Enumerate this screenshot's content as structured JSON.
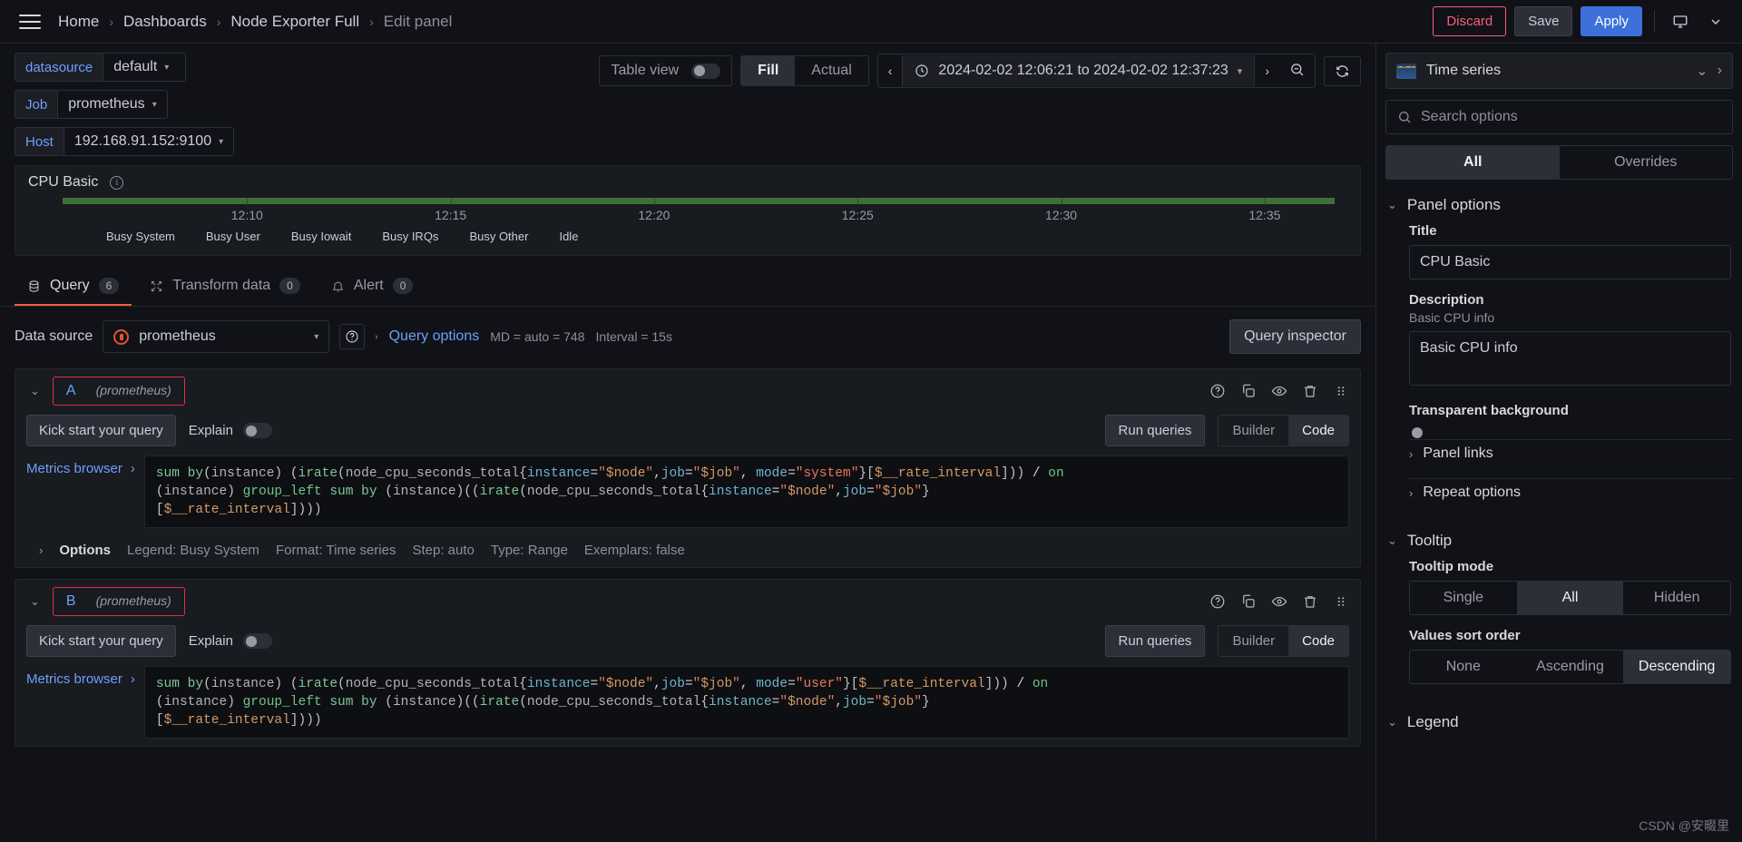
{
  "topnav": {
    "menu_icon": "hamburger-menu-icon",
    "breadcrumbs": [
      "Home",
      "Dashboards",
      "Node Exporter Full",
      "Edit panel"
    ],
    "separator": "›",
    "discard_label": "Discard",
    "save_label": "Save",
    "apply_label": "Apply",
    "tv_icon": "tv-display-icon",
    "chevron_icon": "chevron-down-icon",
    "accent_apply": "#3d71d9",
    "accent_discard": "#f55f7d"
  },
  "variables": [
    {
      "label": "datasource",
      "value": "default"
    },
    {
      "label": "Job",
      "value": "prometheus"
    },
    {
      "label": "Host",
      "value": "192.168.91.152:9100"
    }
  ],
  "toolbar": {
    "table_view_label": "Table view",
    "table_view_on": false,
    "fill_label": "Fill",
    "actual_label": "Actual",
    "fill_active": true,
    "time_range": "2024-02-02 12:06:21 to 2024-02-02 12:37:23",
    "prev_arrow": "‹",
    "next_arrow": "›",
    "clock_icon": "clock-icon",
    "zoom_out_icon": "zoom-out-icon",
    "refresh_icon": "refresh-icon"
  },
  "panel": {
    "title": "CPU Basic",
    "info_icon": "info-circle-icon",
    "series_color": "#56a64b"
  },
  "chart_data": {
    "type": "area",
    "title": "CPU Basic",
    "xlabel": "",
    "ylabel": "",
    "x_ticks": [
      "12:10",
      "12:15",
      "12:20",
      "12:25",
      "12:30",
      "12:35"
    ],
    "legend": [
      "Busy System",
      "Busy User",
      "Busy Iowait",
      "Busy IRQs",
      "Busy Other",
      "Idle"
    ],
    "legend_position": "bottom",
    "grid": true,
    "series": [
      {
        "name": "Busy System",
        "values": [
          0.4,
          0.5,
          0.4,
          0.5,
          0.4,
          0.5
        ]
      },
      {
        "name": "Busy User",
        "values": [
          0.6,
          0.7,
          0.6,
          0.8,
          0.6,
          0.7
        ]
      },
      {
        "name": "Busy Iowait",
        "values": [
          0.1,
          0.1,
          0.1,
          0.1,
          0.1,
          0.1
        ]
      },
      {
        "name": "Busy IRQs",
        "values": [
          0.0,
          0.0,
          0.0,
          0.0,
          0.0,
          0.0
        ]
      },
      {
        "name": "Busy Other",
        "values": [
          0.1,
          0.1,
          0.1,
          0.1,
          0.1,
          0.1
        ]
      },
      {
        "name": "Idle",
        "values": [
          98.8,
          98.6,
          98.8,
          98.5,
          98.8,
          98.6
        ]
      }
    ]
  },
  "tabs": [
    {
      "label": "Query",
      "count": "6",
      "icon": "database-icon",
      "active": true
    },
    {
      "label": "Transform data",
      "count": "0",
      "icon": "transform-icon",
      "active": false
    },
    {
      "label": "Alert",
      "count": "0",
      "icon": "bell-icon",
      "active": false
    }
  ],
  "query_header": {
    "data_source_label": "Data source",
    "data_source_value": "prometheus",
    "help_icon": "help-circle-icon",
    "query_options_label": "Query options",
    "max_data_points": "MD = auto = 748",
    "interval": "Interval = 15s",
    "query_inspector_label": "Query inspector"
  },
  "queries": [
    {
      "ref_id": "A",
      "datasource": "(prometheus)",
      "kick_start_label": "Kick start your query",
      "explain_label": "Explain",
      "explain_on": false,
      "run_queries_label": "Run queries",
      "builder_label": "Builder",
      "code_label": "Code",
      "mode": "Code",
      "metrics_browser_label": "Metrics browser",
      "expr": "sum by(instance) (irate(node_cpu_seconds_total{instance=\"$node\",job=\"$job\", mode=\"system\"}[$__rate_interval])) / on (instance) group_left sum by (instance)((irate(node_cpu_seconds_total{instance=\"$node\",job=\"$job\"}[$__rate_interval])))",
      "options": {
        "label": "Options",
        "legend": "Legend: Busy System",
        "format": "Format: Time series",
        "step": "Step: auto",
        "type": "Type: Range",
        "exemplars": "Exemplars: false"
      }
    },
    {
      "ref_id": "B",
      "datasource": "(prometheus)",
      "kick_start_label": "Kick start your query",
      "explain_label": "Explain",
      "explain_on": false,
      "run_queries_label": "Run queries",
      "builder_label": "Builder",
      "code_label": "Code",
      "mode": "Code",
      "metrics_browser_label": "Metrics browser",
      "expr": "sum by(instance) (irate(node_cpu_seconds_total{instance=\"$node\",job=\"$job\", mode=\"user\"}[$__rate_interval])) / on (instance) group_left sum by (instance)((irate(node_cpu_seconds_total{instance=\"$node\",job=\"$job\"}[$__rate_interval])))"
    }
  ],
  "options_pane": {
    "viz_name": "Time series",
    "viz_icon": "time-series-thumb-icon",
    "viz_caret_icon": "chevron-down-icon",
    "viz_next_icon": "chevron-right-icon",
    "search_placeholder": "Search options",
    "search_icon": "search-icon",
    "all_label": "All",
    "overrides_label": "Overrides",
    "active_filter": "All",
    "panel_options": {
      "section_title": "Panel options",
      "title_label": "Title",
      "title_value": "CPU Basic",
      "description_label": "Description",
      "description_hint": "Basic CPU info",
      "description_value": "Basic CPU info",
      "transparent_label": "Transparent background",
      "transparent_on": false,
      "panel_links_label": "Panel links",
      "repeat_options_label": "Repeat options"
    },
    "tooltip": {
      "section_title": "Tooltip",
      "mode_label": "Tooltip mode",
      "mode_options": [
        "Single",
        "All",
        "Hidden"
      ],
      "mode_selected": "All",
      "sort_label": "Values sort order",
      "sort_options": [
        "None",
        "Ascending",
        "Descending"
      ],
      "sort_selected": "Descending"
    },
    "legend_section_title": "Legend"
  },
  "watermark": "CSDN @安畷里"
}
